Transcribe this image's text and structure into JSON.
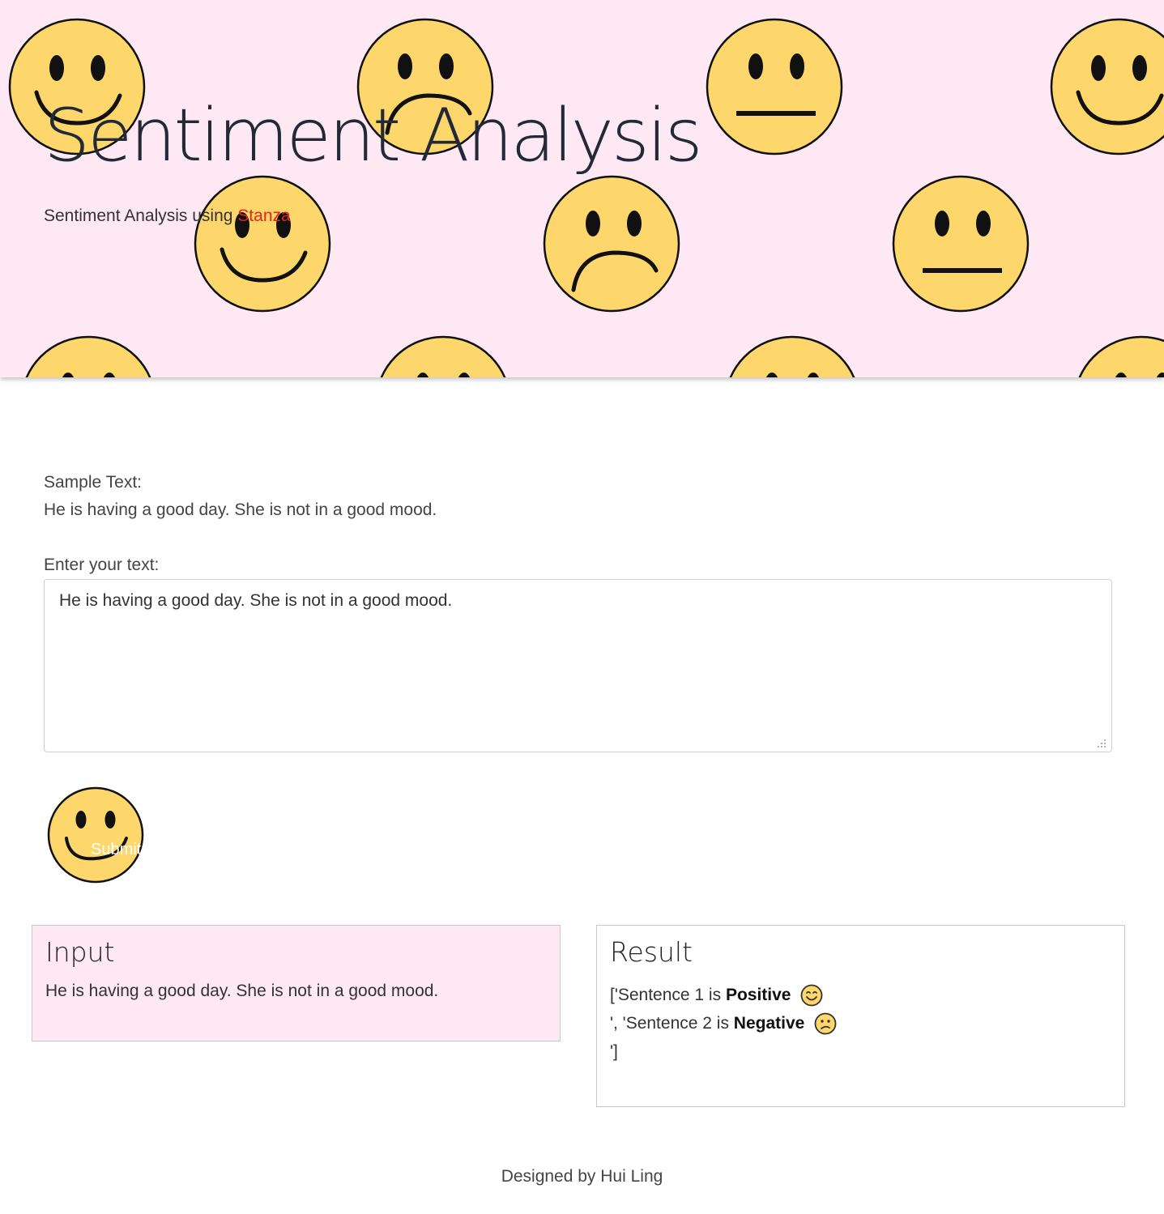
{
  "header": {
    "title": "Sentiment Analysis",
    "subtitle_prefix": "Sentiment Analysis using ",
    "subtitle_link": "Stanza",
    "background_color": "#fde8f4",
    "pattern_icons": [
      "smiley-face-icon",
      "sad-face-icon",
      "neutral-face-icon"
    ]
  },
  "sample": {
    "label": "Sample Text:",
    "text": "He is having a good day. She is not in a good mood."
  },
  "form": {
    "input_label": "Enter your text:",
    "input_value": "He is having a good day. She is not in a good mood. ",
    "submit_label": "Submit",
    "submit_icon": "smiley-face-icon"
  },
  "input_card": {
    "title": "Input",
    "text": "He is having a good day. She is not in a good mood."
  },
  "result_card": {
    "title": "Result",
    "lines": [
      {
        "prefix": "['Sentence 1 is ",
        "label": "Positive",
        "emoji": "smiling-emoji-icon"
      },
      {
        "prefix": "', 'Sentence 2 is ",
        "label": "Negative",
        "emoji": "confused-emoji-icon"
      },
      {
        "prefix": "']",
        "label": "",
        "emoji": ""
      }
    ]
  },
  "footer": {
    "text": "Designed by Hui Ling"
  },
  "colors": {
    "face_fill": "#fdd76b",
    "link": "#e0261d",
    "title": "#222a36"
  }
}
